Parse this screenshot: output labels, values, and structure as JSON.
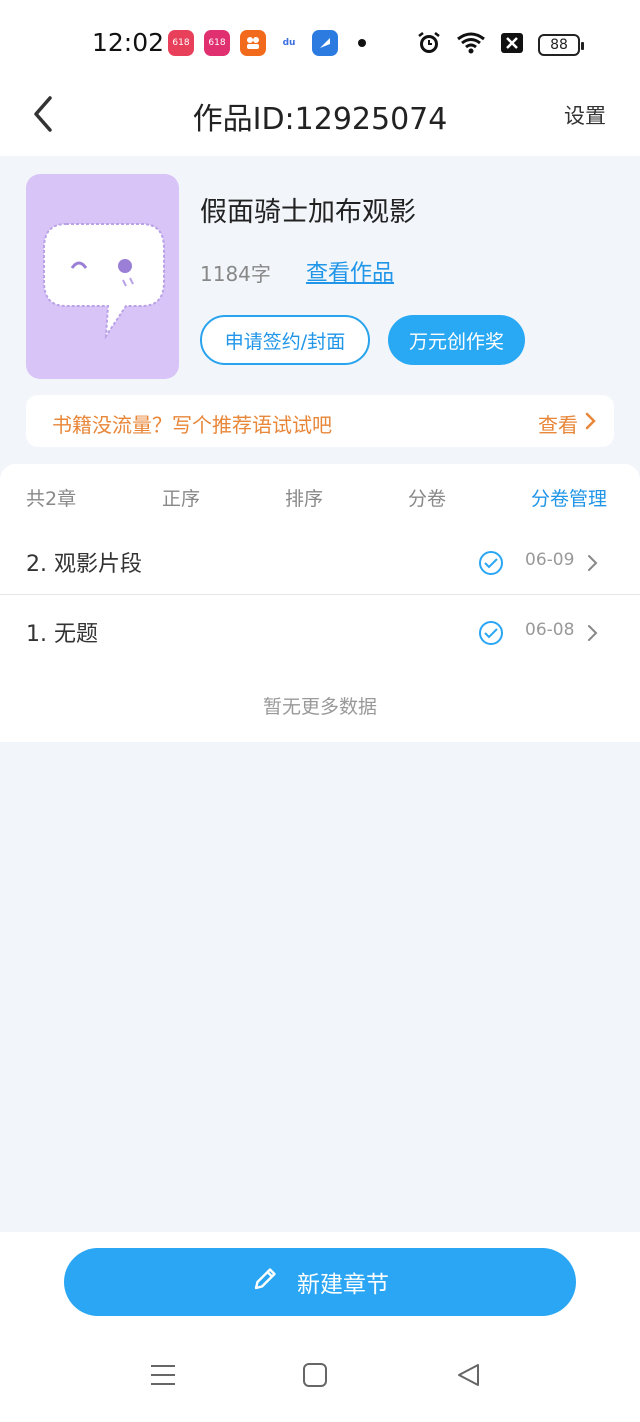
{
  "status_bar": {
    "time": "12:02",
    "apps": [
      {
        "name": "app-icon-618-a",
        "label": "618",
        "color": "#e8405a"
      },
      {
        "name": "app-icon-618-b",
        "label": "618",
        "color": "#e0306f"
      },
      {
        "name": "app-icon-orange",
        "label": "",
        "color": "#f26a1b"
      },
      {
        "name": "app-icon-baidu",
        "label": "du",
        "color": "#3b6fe0"
      },
      {
        "name": "app-icon-blue",
        "label": "",
        "color": "#2b7be0"
      }
    ],
    "battery": "88"
  },
  "header": {
    "title": "作品ID:12925074",
    "settings_label": "设置"
  },
  "book": {
    "title": "假面骑士加布观影",
    "word_count": "1184字",
    "view_work_label": "查看作品",
    "apply_sign_label": "申请签约/封面",
    "award_label": "万元创作奖",
    "cover_color": "#d9c4f7"
  },
  "promo": {
    "text": "书籍没流量？写个推荐语试试吧",
    "link_label": "查看"
  },
  "toolbar": {
    "count": "共2章",
    "asc": "正序",
    "sort": "排序",
    "volume": "分卷",
    "volume_manage": "分卷管理"
  },
  "chapters": [
    {
      "title": "2. 观影片段",
      "date": "06-09"
    },
    {
      "title": "1. 无题",
      "date": "06-08"
    }
  ],
  "no_more_text": "暂无更多数据",
  "new_chapter_label": "新建章节",
  "colors": {
    "accent": "#2aa6f4",
    "promo": "#e8873a",
    "background": "#f2f6fa"
  }
}
